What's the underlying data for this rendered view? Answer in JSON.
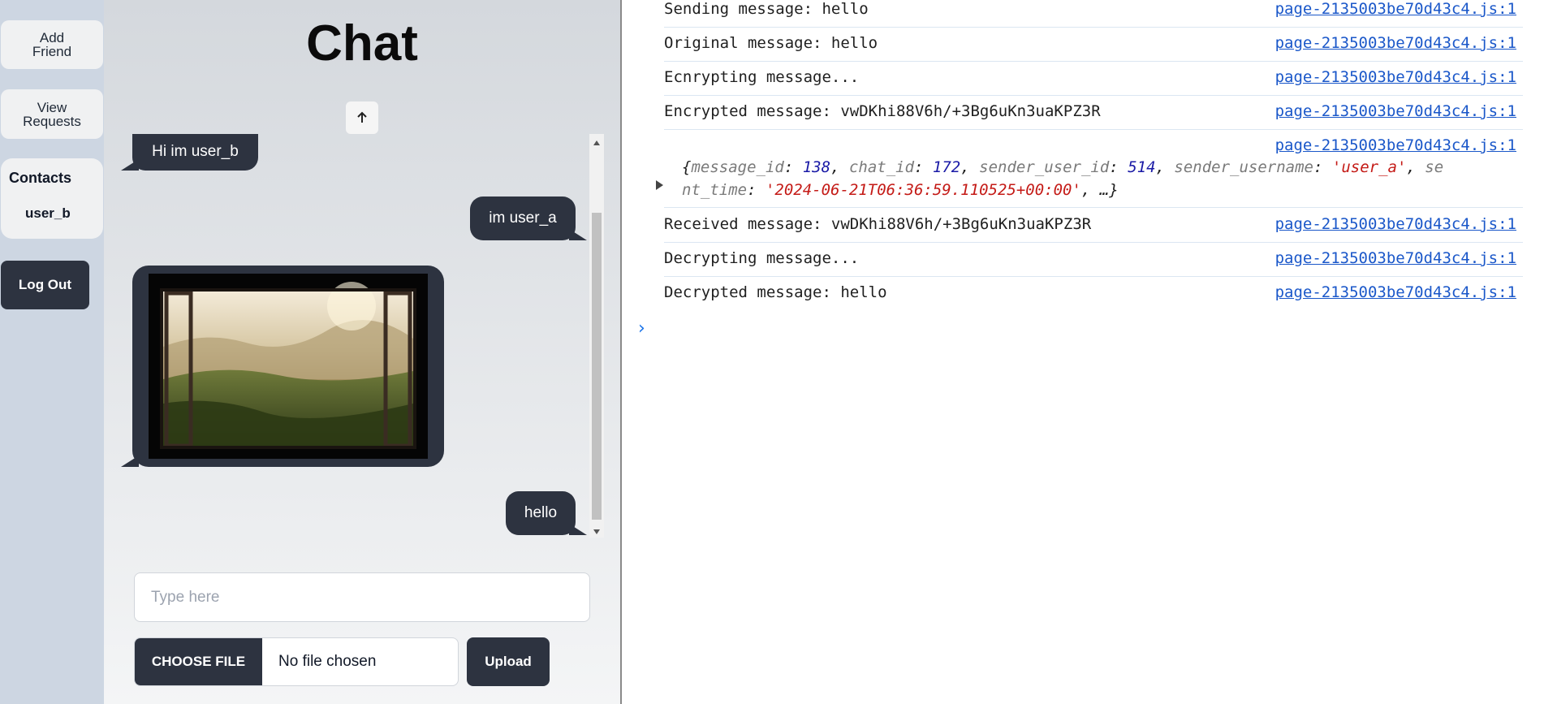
{
  "sidebar": {
    "add_friend": "Add\nFriend",
    "view_requests": "View\nRequests",
    "contacts_title": "Contacts",
    "contacts": [
      "user_b"
    ],
    "logout": "Log Out"
  },
  "chat": {
    "title": "Chat",
    "messages": [
      {
        "from": "other",
        "type": "text",
        "text": "Hi im user_b"
      },
      {
        "from": "self",
        "type": "text",
        "text": "im user_a"
      },
      {
        "from": "other",
        "type": "image"
      },
      {
        "from": "self",
        "type": "text",
        "text": "hello"
      }
    ],
    "input_placeholder": "Type here",
    "choose_file": "CHOOSE FILE",
    "file_status": "No file chosen",
    "upload": "Upload"
  },
  "console": {
    "source": "page-2135003be70d43c4.js:1",
    "logs": [
      "Sending message: hello",
      "Original message: hello",
      "Ecnrypting message...",
      "Encrypted message: vwDKhi88V6h/+3Bg6uKn3uaKPZ3R",
      "Received message: vwDKhi88V6h/+3Bg6uKn3uaKPZ3R",
      "Decrypting message...",
      "Decrypted message: hello"
    ],
    "object": {
      "message_id_key": "message_id",
      "message_id": "138",
      "chat_id_key": "chat_id",
      "chat_id": "172",
      "sender_user_id_key": "sender_user_id",
      "sender_user_id": "514",
      "sender_username_key": "sender_username",
      "sender_username": "'user_a'",
      "sent_time_key_part1": "se",
      "sent_time_key_part2": "nt_time",
      "sent_time": "'2024-06-21T06:36:59.110525+00:00'",
      "ellipsis": "…"
    },
    "prompt": "›"
  },
  "colors": {
    "sidebar_bg": "#cdd6e2",
    "dark_button": "#2d3340",
    "link": "#1a57c9"
  }
}
